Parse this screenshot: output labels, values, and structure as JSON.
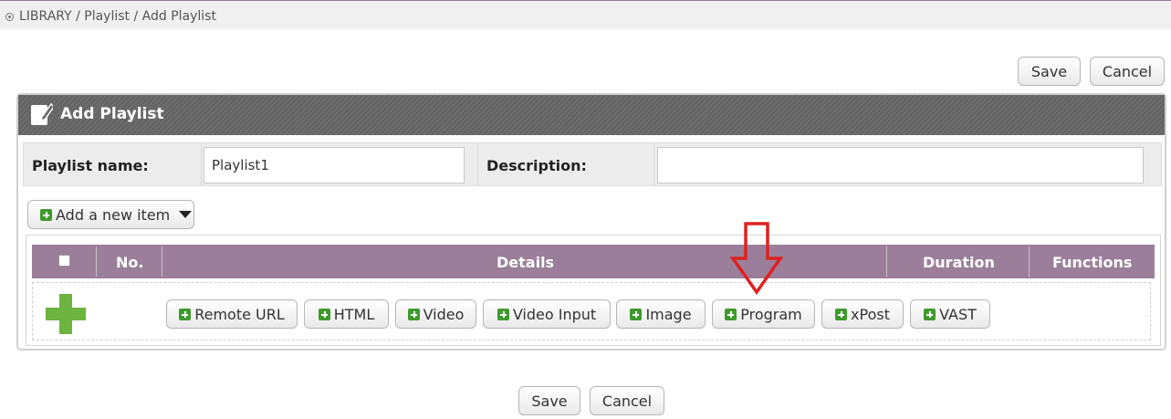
{
  "breadcrumb": {
    "icon": "target-icon",
    "text": "LIBRARY / Playlist / Add Playlist"
  },
  "top_actions": {
    "save_label": "Save",
    "cancel_label": "Cancel"
  },
  "panel": {
    "title": "Add Playlist",
    "header_icon": "edit-icon",
    "header_color": "#6a6a6a"
  },
  "form": {
    "name_label": "Playlist name:",
    "name_value": "Playlist1",
    "description_label": "Description:",
    "description_value": ""
  },
  "add_item": {
    "label": "Add a new item",
    "icon": "plus-icon",
    "caret_icon": "caret-down-icon"
  },
  "table": {
    "header_color": "#9b7f9a",
    "columns": [
      "No.",
      "Details",
      "Duration",
      "Functions"
    ]
  },
  "item_types": [
    "Remote URL",
    "HTML",
    "Video",
    "Video Input",
    "Image",
    "Program",
    "xPost",
    "VAST"
  ],
  "annotation": {
    "arrow_color": "#e02020",
    "points_to": "Program"
  },
  "bottom_actions": {
    "save_label": "Save",
    "cancel_label": "Cancel"
  },
  "colors": {
    "accent_green": "#3f9a2e",
    "big_plus_green": "#6db33f"
  }
}
